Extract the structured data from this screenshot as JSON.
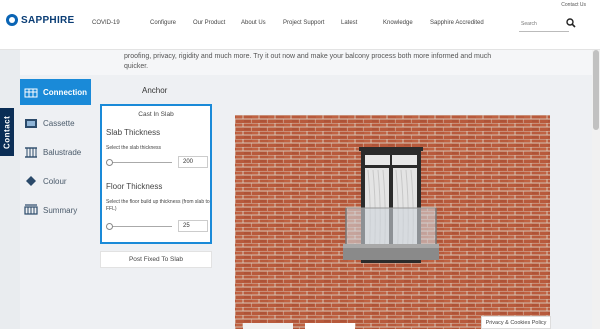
{
  "header": {
    "logo_text": "SAPPHIRE",
    "contact_us": "Contact Us",
    "nav": [
      "COVID-19",
      "Configure",
      "Our Product",
      "About Us",
      "Project Support",
      "Latest",
      "Knowledge",
      "Sapphire Accredited"
    ],
    "search_placeholder": "Search"
  },
  "intro": {
    "text": "proofing, privacy, rigidity and much more. Try it out now and make your balcony process both more informed and much quicker."
  },
  "sidebar": {
    "contact_tab": "Contact",
    "items": [
      {
        "label": "Connection",
        "icon": "connection-icon",
        "active": true
      },
      {
        "label": "Cassette",
        "icon": "cassette-icon",
        "active": false
      },
      {
        "label": "Balustrade",
        "icon": "balustrade-icon",
        "active": false
      },
      {
        "label": "Colour",
        "icon": "colour-icon",
        "active": false
      },
      {
        "label": "Summary",
        "icon": "summary-icon",
        "active": false
      }
    ]
  },
  "anchor": {
    "title": "Anchor",
    "option_selected": "Cast In Slab",
    "slab_heading": "Slab Thickness",
    "slab_desc": "Select the slab thickness",
    "slab_value": "200",
    "floor_heading": "Floor Thickness",
    "floor_desc": "Select the floor build up thickness (from slab to FFL)",
    "floor_value": "25",
    "other_option": "Post Fixed To Slab"
  },
  "cookie_label": "Privacy & Cookies Policy",
  "colors": {
    "accent": "#1a8ad8",
    "brand_dark": "#0a2d55",
    "brick": "#b5573a",
    "frame": "#2b2b2b"
  }
}
